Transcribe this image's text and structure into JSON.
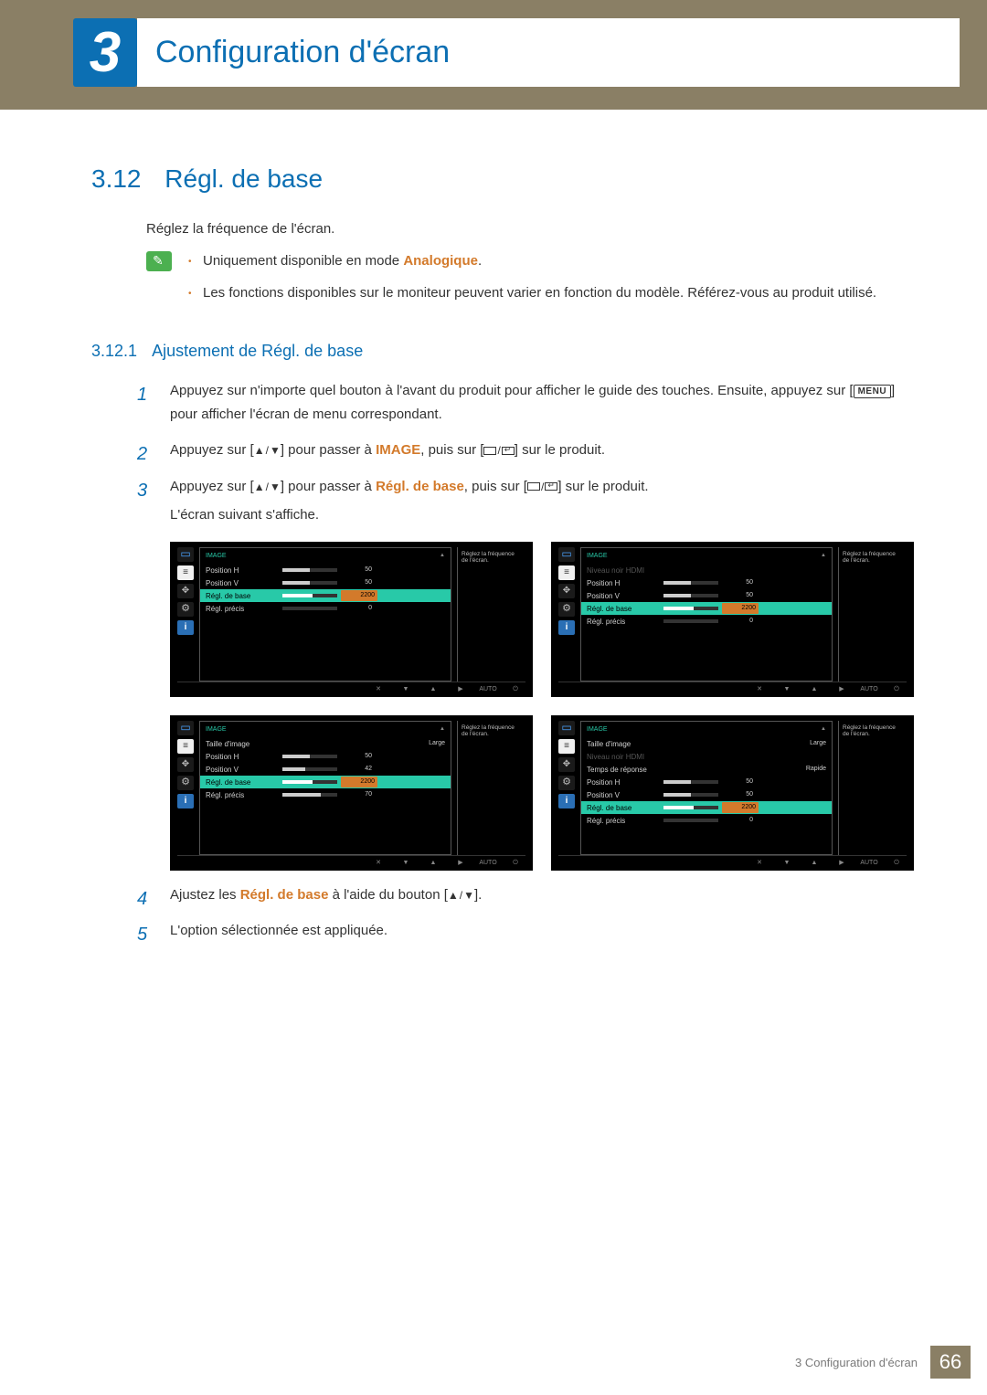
{
  "chapter": {
    "number": "3",
    "title": "Configuration d'écran"
  },
  "section": {
    "number": "3.12",
    "title": "Régl. de base"
  },
  "intro": "Réglez la fréquence de l'écran.",
  "notes": {
    "item1_pre": "Uniquement disponible en mode ",
    "item1_kw": "Analogique",
    "item1_post": ".",
    "item2": "Les fonctions disponibles sur le moniteur peuvent varier en fonction du modèle. Référez-vous au produit utilisé."
  },
  "subsection": {
    "number": "3.12.1",
    "title": "Ajustement de Régl. de base"
  },
  "steps": {
    "s1a": "Appuyez sur n'importe quel bouton à l'avant du produit pour afficher le guide des touches. Ensuite, appuyez sur [",
    "s1_menu": "MENU",
    "s1b": "] pour afficher l'écran de menu correspondant.",
    "s2a": "Appuyez sur [",
    "s2b": "] pour passer à ",
    "s2_kw": "IMAGE",
    "s2c": ", puis sur [",
    "s2d": "] sur le produit.",
    "s3a": "Appuyez sur [",
    "s3b": "] pour passer à ",
    "s3_kw": "Régl. de base",
    "s3c": ", puis sur [",
    "s3d": "] sur le produit.",
    "s3e": "L'écran suivant s'affiche.",
    "s4a": "Ajustez les ",
    "s4_kw": "Régl. de base",
    "s4b": " à l'aide du bouton [",
    "s4c": "].",
    "s5": "L'option sélectionnée est appliquée."
  },
  "osd": {
    "header_title": "IMAGE",
    "side_desc": "Réglez la fréquence de l'écran.",
    "footer": {
      "b1": "✕",
      "b2": "▼",
      "b3": "▲",
      "b4": "▶",
      "b5": "AUTO",
      "b6": "⏻"
    },
    "labels": {
      "posH": "Position H",
      "posV": "Position V",
      "regl": "Régl. de base",
      "precis": "Régl. précis",
      "taille": "Taille d'image",
      "hdmi": "Niveau noir HDMI",
      "temps": "Temps de réponse",
      "large": "Large",
      "rapide": "Rapide"
    },
    "panel1": {
      "rows": [
        {
          "label": "Position H",
          "bar": 50,
          "val": "50"
        },
        {
          "label": "Position V",
          "bar": 50,
          "val": "50"
        },
        {
          "label": "Régl. de base",
          "bar": 55,
          "val": "2200",
          "sel": true
        },
        {
          "label": "Régl. précis",
          "bar": 0,
          "val": "0"
        }
      ]
    },
    "panel2": {
      "rows": [
        {
          "label": "Niveau noir HDMI",
          "dim": true,
          "val": ""
        },
        {
          "label": "Position H",
          "bar": 50,
          "val": "50"
        },
        {
          "label": "Position V",
          "bar": 50,
          "val": "50"
        },
        {
          "label": "Régl. de base",
          "bar": 55,
          "val": "2200",
          "sel": true
        },
        {
          "label": "Régl. précis",
          "bar": 0,
          "val": "0"
        }
      ]
    },
    "panel3": {
      "rows": [
        {
          "label": "Taille d'image",
          "text": "Large"
        },
        {
          "label": "Position H",
          "bar": 50,
          "val": "50"
        },
        {
          "label": "Position V",
          "bar": 42,
          "val": "42"
        },
        {
          "label": "Régl. de base",
          "bar": 55,
          "val": "2200",
          "sel": true
        },
        {
          "label": "Régl. précis",
          "bar": 70,
          "val": "70"
        }
      ]
    },
    "panel4": {
      "rows": [
        {
          "label": "Taille d'image",
          "text": "Large"
        },
        {
          "label": "Niveau noir HDMI",
          "dim": true,
          "val": ""
        },
        {
          "label": "Temps de réponse",
          "text": "Rapide"
        },
        {
          "label": "Position H",
          "bar": 50,
          "val": "50"
        },
        {
          "label": "Position V",
          "bar": 50,
          "val": "50"
        },
        {
          "label": "Régl. de base",
          "bar": 55,
          "val": "2200",
          "sel": true
        },
        {
          "label": "Régl. précis",
          "bar": 0,
          "val": "0"
        }
      ]
    }
  },
  "footer": {
    "text": "3 Configuration d'écran",
    "page": "66"
  }
}
